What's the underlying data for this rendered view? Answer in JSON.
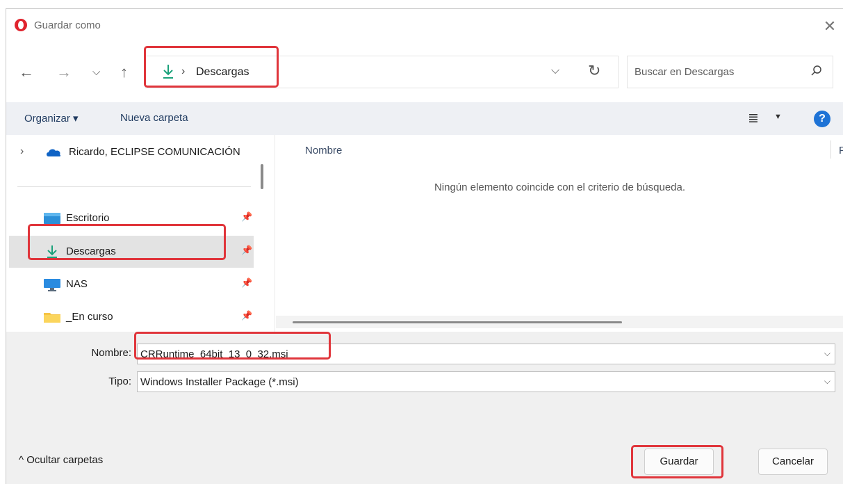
{
  "window": {
    "title": "Guardar como",
    "app_icon": "opera-icon"
  },
  "nav": {
    "back_icon": "back-arrow-icon",
    "forward_icon": "forward-arrow-icon",
    "recent_icon": "chevron-down-icon",
    "up_icon": "up-arrow-icon",
    "breadcrumb_sep": "›",
    "current_folder": "Descargas",
    "search_placeholder": "Buscar en Descargas"
  },
  "toolbar": {
    "organize_label": "Organizar ▾",
    "new_folder_label": "Nueva carpeta"
  },
  "sidebar": {
    "cloud_item": "Ricardo, ECLIPSE COMUNICACIÓN",
    "items": [
      {
        "label": "Escritorio",
        "icon": "desktop-icon"
      },
      {
        "label": "Descargas",
        "icon": "download-icon",
        "selected": true
      },
      {
        "label": "NAS",
        "icon": "monitor-icon"
      },
      {
        "label": "_En curso",
        "icon": "folder-icon"
      }
    ]
  },
  "file_list": {
    "column_name": "Nombre",
    "column_next": "F",
    "empty_message": "Ningún elemento coincide con el criterio de búsqueda."
  },
  "form": {
    "name_label": "Nombre:",
    "name_value": "CRRuntime_64bit_13_0_32.msi",
    "type_label": "Tipo:",
    "type_value": "Windows Installer Package (*.msi)"
  },
  "footer": {
    "hide_folders_label": "^  Ocultar carpetas",
    "save_label": "Guardar",
    "cancel_label": "Cancelar"
  },
  "colors": {
    "highlight": "#e0353b",
    "accent": "#1e73d6",
    "download_green": "#1aa17a"
  }
}
